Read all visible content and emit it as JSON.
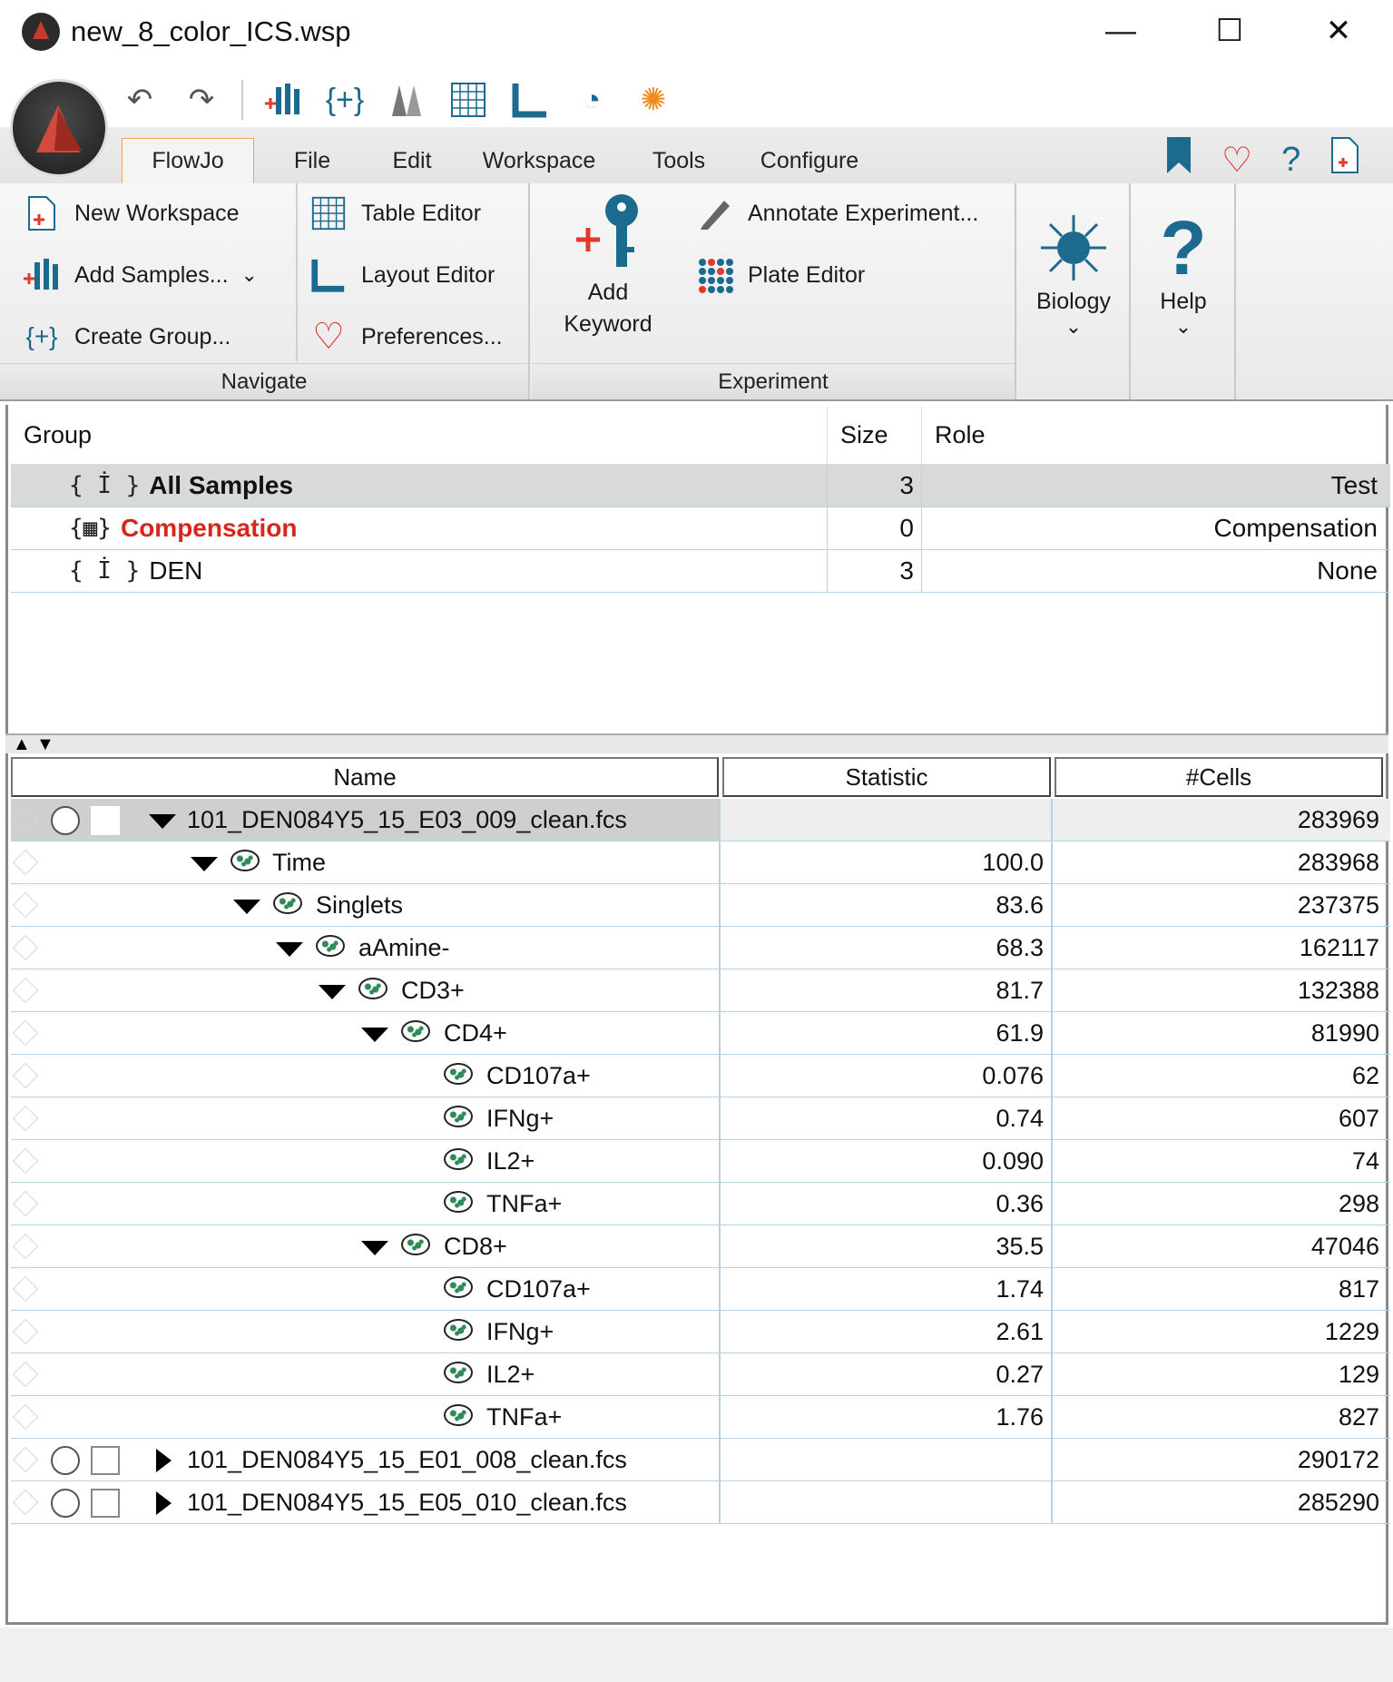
{
  "window": {
    "title": "new_8_color_ICS.wsp",
    "minimize_glyph": "—",
    "maximize_glyph": "☐",
    "close_glyph": "✕"
  },
  "quick_access": {
    "undo_icon": "undo-icon",
    "redo_icon": "redo-icon",
    "tools": [
      "add-samples-icon",
      "create-group-icon",
      "compare-icon",
      "table-editor-icon",
      "layout-editor-icon",
      "refresh-icon",
      "sun-icon"
    ]
  },
  "menu": {
    "tabs": [
      "FlowJo",
      "File",
      "Edit",
      "Workspace",
      "Tools",
      "Configure"
    ],
    "active_tab": "FlowJo"
  },
  "ribbon": {
    "navigate": {
      "label": "Navigate",
      "new_workspace": "New Workspace",
      "add_samples": "Add Samples...",
      "create_group": "Create Group...",
      "table_editor": "Table Editor",
      "layout_editor": "Layout Editor",
      "preferences": "Preferences..."
    },
    "experiment": {
      "label": "Experiment",
      "add_keyword_line1": "Add",
      "add_keyword_line2": "Keyword",
      "annotate": "Annotate Experiment...",
      "plate_editor": "Plate Editor"
    },
    "biology": "Biology",
    "help": "Help"
  },
  "group_table": {
    "headers": {
      "group": "Group",
      "size": "Size",
      "role": "Role"
    },
    "rows": [
      {
        "icon": "{ İ }",
        "name": "All Samples",
        "size": "3",
        "role": "Test"
      },
      {
        "icon": "{▦}",
        "name": "Compensation",
        "size": "0",
        "role": "Compensation"
      },
      {
        "icon": "{ İ }",
        "name": "DEN",
        "size": "3",
        "role": "None"
      }
    ]
  },
  "sample_table": {
    "headers": {
      "name": "Name",
      "statistic": "Statistic",
      "cells": "#Cells"
    },
    "rows": [
      {
        "name": "101_DEN084Y5_15_E03_009_clean.fcs",
        "statistic": "",
        "cells": "283969"
      },
      {
        "name": "Time",
        "statistic": "100.0",
        "cells": "283968"
      },
      {
        "name": "Singlets",
        "statistic": "83.6",
        "cells": "237375"
      },
      {
        "name": "aAmine-",
        "statistic": "68.3",
        "cells": "162117"
      },
      {
        "name": "CD3+",
        "statistic": "81.7",
        "cells": "132388"
      },
      {
        "name": "CD4+",
        "statistic": "61.9",
        "cells": "81990"
      },
      {
        "name": "CD107a+",
        "statistic": "0.076",
        "cells": "62"
      },
      {
        "name": "IFNg+",
        "statistic": "0.74",
        "cells": "607"
      },
      {
        "name": "IL2+",
        "statistic": "0.090",
        "cells": "74"
      },
      {
        "name": "TNFa+",
        "statistic": "0.36",
        "cells": "298"
      },
      {
        "name": "CD8+",
        "statistic": "35.5",
        "cells": "47046"
      },
      {
        "name": "CD107a+",
        "statistic": "1.74",
        "cells": "817"
      },
      {
        "name": "IFNg+",
        "statistic": "2.61",
        "cells": "1229"
      },
      {
        "name": "IL2+",
        "statistic": "0.27",
        "cells": "129"
      },
      {
        "name": "TNFa+",
        "statistic": "1.76",
        "cells": "827"
      },
      {
        "name": "101_DEN084Y5_15_E01_008_clean.fcs",
        "statistic": "",
        "cells": "290172"
      },
      {
        "name": "101_DEN084Y5_15_E05_010_clean.fcs",
        "statistic": "",
        "cells": "285290"
      }
    ]
  },
  "colors": {
    "accent_orange": "#f1a64a",
    "brand_red": "#d8261c",
    "row_border": "#b6d2e6",
    "teal": "#1d6a8f"
  }
}
